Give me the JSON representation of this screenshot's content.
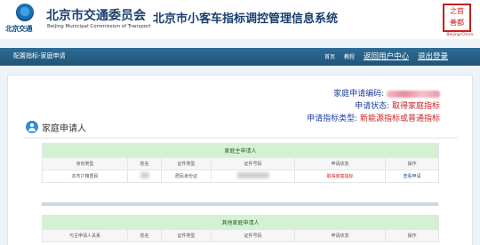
{
  "header": {
    "logo_text": "北京交通",
    "org_cn": "北京市交通委员会",
    "org_en": "Beijing Municipal Commission of Transport",
    "system_title": "北京市小客车指标调控管理信息系统",
    "seal_lines": [
      "之首",
      "善都"
    ],
    "seal_sub": "Beijing·China"
  },
  "nav": {
    "breadcrumb": "配置指标-家庭申请",
    "home": "首页",
    "tutorial": "教程",
    "back_user_center": "返回用户中心",
    "logout": "退出登录"
  },
  "info": {
    "code_label": "家庭申请编码:",
    "status_label": "申请状态:",
    "status_value": "取得家庭指标",
    "type_label": "申请指标类型:",
    "type_value": "新能源指标或普通指标"
  },
  "section": {
    "title": "家庭申请人"
  },
  "main_table": {
    "caption": "家庭主申请人",
    "headers": [
      "身份类型",
      "姓名",
      "证件类型",
      "证件号码",
      "申请状态",
      "操作"
    ],
    "row": {
      "identity": "本市户籍居民",
      "id_type": "居民身份证",
      "status": "取得家庭指标",
      "action": "查看申请"
    }
  },
  "other_table": {
    "caption": "其他家庭申请人",
    "headers": [
      "与主申请人关系",
      "姓名",
      "证件类型",
      "证件号码",
      "申请状态",
      "操作"
    ]
  },
  "colors": {
    "nav_bg": "#2f6c96",
    "accent_red": "#cc2121",
    "label_blue": "#1d3f9f",
    "table_caption": "#d4f1d4"
  }
}
